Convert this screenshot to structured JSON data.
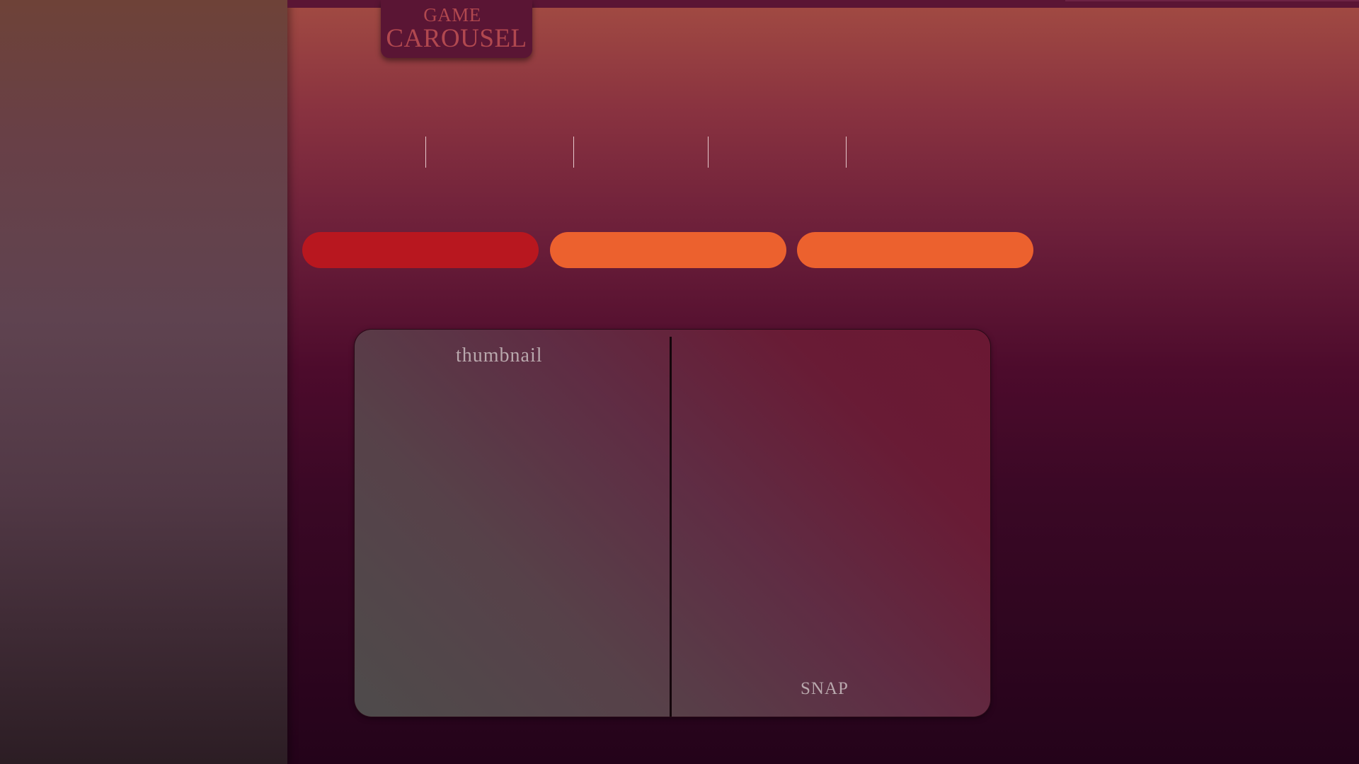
{
  "app": {
    "logo": {
      "line1": "GAME",
      "line2": "CAROUSEL"
    }
  },
  "carousel": {
    "thumbnail_label": "thumbnail",
    "snap_label": "SNAP"
  },
  "colors": {
    "pill_active": "#b8171f",
    "pill_inactive": "#ec612e",
    "logo_text": "#b1484f",
    "label_text": "#b9a8ad"
  }
}
